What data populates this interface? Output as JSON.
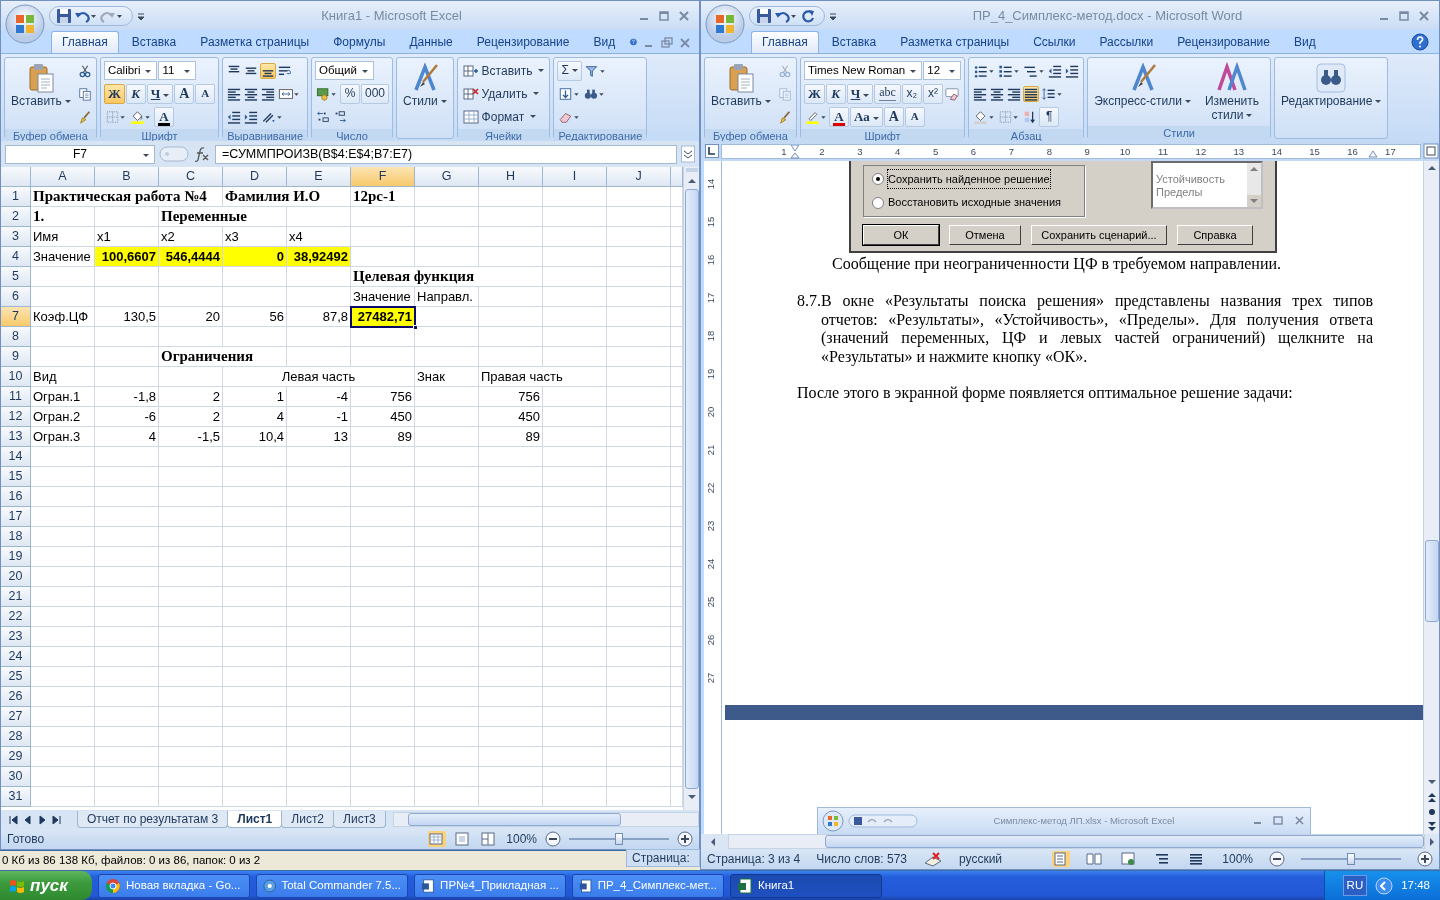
{
  "excel": {
    "title": "Книга1  -  Microsoft Excel",
    "tabs": [
      {
        "label": "Главная",
        "selected": true
      },
      {
        "label": "Вставка",
        "selected": false
      },
      {
        "label": "Разметка страницы",
        "selected": false
      },
      {
        "label": "Формулы",
        "selected": false
      },
      {
        "label": "Данные",
        "selected": false
      },
      {
        "label": "Рецензирование",
        "selected": false
      },
      {
        "label": "Вид",
        "selected": false
      }
    ],
    "ribbon": [
      {
        "title": "Буфер обмена",
        "controls": [
          {
            "kind": "paste",
            "label": "Вставить"
          },
          {
            "kind": "stack",
            "lines": [
              [
                {
                  "kind": "scissors",
                  "disabled": false
                }
              ],
              [
                {
                  "kind": "copy",
                  "disabled": false
                }
              ],
              [
                {
                  "kind": "brush",
                  "disabled": false
                }
              ]
            ]
          }
        ]
      },
      {
        "title": "Шрифт",
        "controls": [
          {
            "kind": "stack",
            "lines": [
              [
                {
                  "kind": "combo",
                  "value": "Calibri"
                },
                {
                  "kind": "combo",
                  "value": "11"
                }
              ],
              [
                {
                  "kind": "bold-glyph",
                  "label": "Ж",
                  "on": true
                },
                {
                  "kind": "italic-glyph",
                  "label": "К",
                  "on": false
                },
                {
                  "kind": "underline-glyph",
                  "label": "Ч",
                  "on": false
                },
                {
                  "kind": "grow-glyph",
                  "label": "A",
                  "on": false
                },
                {
                  "kind": "shrink-glyph",
                  "label": "A",
                  "on": false
                }
              ],
              [
                {
                  "kind": "border"
                },
                {
                  "kind": "fill"
                },
                {
                  "kind": "fontcolor-glyph",
                  "label": "A",
                  "color": "#000000"
                }
              ]
            ]
          }
        ]
      },
      {
        "title": "Выравнивание",
        "controls": [
          {
            "kind": "stack",
            "lines": [
              [
                {
                  "kind": "align-top",
                  "on": false
                },
                {
                  "kind": "align-middle",
                  "on": false
                },
                {
                  "kind": "align-bottom",
                  "on": true
                },
                {
                  "kind": "wrap",
                  "on": false
                }
              ],
              [
                {
                  "kind": "align-left"
                },
                {
                  "kind": "align-center"
                },
                {
                  "kind": "align-right"
                },
                {
                  "kind": "merge"
                }
              ],
              [
                {
                  "kind": "outdent"
                },
                {
                  "kind": "indent"
                },
                {
                  "kind": "orientation"
                }
              ]
            ]
          }
        ]
      },
      {
        "title": "Число",
        "controls": [
          {
            "kind": "stack",
            "lines": [
              [
                {
                  "kind": "combo",
                  "value": "Общий"
                }
              ],
              [
                {
                  "kind": "currency"
                },
                {
                  "kind": "glyph",
                  "label": "%"
                },
                {
                  "kind": "glyph",
                  "label": "000"
                }
              ],
              [
                {
                  "kind": "inc-decimal"
                },
                {
                  "kind": "dec-decimal"
                }
              ]
            ]
          }
        ]
      },
      {
        "controls": [
          {
            "kind": "styles",
            "label": "Стили"
          }
        ]
      },
      {
        "title": "Ячейки",
        "controls": [
          {
            "kind": "stack",
            "lines": [
              [
                {
                  "kind": "insert-cells",
                  "label": "Вставить"
                }
              ],
              [
                {
                  "kind": "delete-cells",
                  "label": "Удалить"
                }
              ],
              [
                {
                  "kind": "format-cells",
                  "label": "Формат"
                }
              ]
            ]
          }
        ]
      },
      {
        "title": "Редактирование",
        "controls": [
          {
            "kind": "stack",
            "lines": [
              [
                {
                  "kind": "sum-glyph",
                  "label": "Σ"
                },
                {
                  "kind": "sort-filter"
                }
              ],
              [
                {
                  "kind": "fill-down"
                },
                {
                  "kind": "binoculars"
                }
              ],
              [
                {
                  "kind": "eraser"
                }
              ]
            ]
          }
        ]
      }
    ],
    "name_box": "F7",
    "formula": "=СУММПРОИЗВ(B$4:E$4;B7:E7)",
    "columns": [
      "A",
      "B",
      "C",
      "D",
      "E",
      "F",
      "G",
      "H",
      "I",
      "J"
    ],
    "rows": [
      {
        "header": "1",
        "cells": [
          {
            "kind": "heading",
            "text": "Практическая работа №4",
            "selected": false
          },
          {
            "kind": "empty"
          },
          {
            "kind": "empty"
          },
          {
            "kind": "heading",
            "text": "Фамилия И.О",
            "selected": false
          },
          {
            "kind": "empty"
          },
          {
            "kind": "heading",
            "text": "12рс-1",
            "selected": false
          }
        ]
      },
      {
        "header": "2",
        "cells": [
          {
            "kind": "heading",
            "text": "1.",
            "selected": false
          },
          {
            "kind": "empty"
          },
          {
            "kind": "heading",
            "text": "Переменные",
            "selected": false
          }
        ]
      },
      {
        "header": "3",
        "cells": [
          {
            "kind": "text",
            "text": "Имя",
            "selected": false
          },
          {
            "kind": "text",
            "text": "x1",
            "selected": false
          },
          {
            "kind": "text",
            "text": "x2",
            "selected": false
          },
          {
            "kind": "text",
            "text": "x3",
            "selected": false
          },
          {
            "kind": "text",
            "text": "x4",
            "selected": false
          }
        ]
      },
      {
        "header": "4",
        "cells": [
          {
            "kind": "text",
            "text": "Значение",
            "selected": false
          },
          {
            "kind": "number",
            "text": "100,6607",
            "bold": true,
            "highlight": true,
            "selected": false
          },
          {
            "kind": "number",
            "text": "546,4444",
            "bold": true,
            "highlight": true,
            "selected": false
          },
          {
            "kind": "number",
            "text": "0",
            "bold": true,
            "highlight": true,
            "selected": false
          },
          {
            "kind": "number",
            "text": "38,92492",
            "bold": true,
            "highlight": true,
            "selected": false
          }
        ]
      },
      {
        "header": "5",
        "cells": [
          {
            "kind": "empty"
          },
          {
            "kind": "empty"
          },
          {
            "kind": "empty"
          },
          {
            "kind": "empty"
          },
          {
            "kind": "empty"
          },
          {
            "kind": "heading",
            "text": "Целевая функция",
            "selected": false
          }
        ]
      },
      {
        "header": "6",
        "cells": [
          {
            "kind": "empty"
          },
          {
            "kind": "empty"
          },
          {
            "kind": "empty"
          },
          {
            "kind": "empty"
          },
          {
            "kind": "empty"
          },
          {
            "kind": "text",
            "text": "Значение",
            "selected": false
          },
          {
            "kind": "text",
            "text": "Направл.",
            "selected": false
          }
        ]
      },
      {
        "header": "7",
        "cells": [
          {
            "kind": "text",
            "text": "Коэф.ЦФ",
            "selected": false
          },
          {
            "kind": "number",
            "text": "130,5",
            "selected": false
          },
          {
            "kind": "number",
            "text": "20",
            "selected": false
          },
          {
            "kind": "number",
            "text": "56",
            "selected": false
          },
          {
            "kind": "number",
            "text": "87,8",
            "selected": false
          },
          {
            "kind": "number",
            "text": "27482,71",
            "bold": true,
            "highlight": true,
            "selected": true
          }
        ]
      },
      {
        "header": "8"
      },
      {
        "header": "9",
        "cells": [
          {
            "kind": "empty"
          },
          {
            "kind": "empty"
          },
          {
            "kind": "heading",
            "text": "Ограничения",
            "selected": false
          }
        ]
      },
      {
        "header": "10",
        "cells": [
          {
            "kind": "text",
            "text": "Вид",
            "selected": false
          },
          {
            "kind": "empty"
          },
          {
            "kind": "empty"
          },
          {
            "kind": "empty"
          },
          {
            "kind": "text",
            "text": "Левая часть",
            "centered": true,
            "selected": false
          },
          {
            "kind": "empty"
          },
          {
            "kind": "text",
            "text": "Знак",
            "selected": false
          },
          {
            "kind": "text",
            "text": "Правая часть",
            "selected": false
          }
        ]
      },
      {
        "header": "11",
        "cells": [
          {
            "kind": "text",
            "text": "Огран.1",
            "selected": false
          },
          {
            "kind": "number",
            "text": "-1,8",
            "selected": false
          },
          {
            "kind": "number",
            "text": "2",
            "selected": false
          },
          {
            "kind": "number",
            "text": "1",
            "selected": false
          },
          {
            "kind": "number",
            "text": "-4",
            "selected": false
          },
          {
            "kind": "number",
            "text": "756",
            "selected": false
          },
          {
            "kind": "empty"
          },
          {
            "kind": "number",
            "text": "756",
            "selected": false
          }
        ]
      },
      {
        "header": "12",
        "cells": [
          {
            "kind": "text",
            "text": "Огран.2",
            "selected": false
          },
          {
            "kind": "number",
            "text": "-6",
            "selected": false
          },
          {
            "kind": "number",
            "text": "2",
            "selected": false
          },
          {
            "kind": "number",
            "text": "4",
            "selected": false
          },
          {
            "kind": "number",
            "text": "-1",
            "selected": false
          },
          {
            "kind": "number",
            "text": "450",
            "selected": false
          },
          {
            "kind": "empty"
          },
          {
            "kind": "number",
            "text": "450",
            "selected": false
          }
        ]
      },
      {
        "header": "13",
        "cells": [
          {
            "kind": "text",
            "text": "Огран.3",
            "selected": false
          },
          {
            "kind": "number",
            "text": "4",
            "selected": false
          },
          {
            "kind": "number",
            "text": "-1,5",
            "selected": false
          },
          {
            "kind": "number",
            "text": "10,4",
            "selected": false
          },
          {
            "kind": "number",
            "text": "13",
            "selected": false
          },
          {
            "kind": "number",
            "text": "89",
            "selected": false
          },
          {
            "kind": "empty"
          },
          {
            "kind": "number",
            "text": "89",
            "selected": false
          }
        ]
      },
      {
        "header": "14"
      },
      {
        "header": "15"
      },
      {
        "header": "16"
      },
      {
        "header": "17"
      },
      {
        "header": "18"
      },
      {
        "header": "19"
      },
      {
        "header": "20"
      },
      {
        "header": "21"
      },
      {
        "header": "22"
      },
      {
        "header": "23"
      },
      {
        "header": "24"
      },
      {
        "header": "25"
      },
      {
        "header": "26"
      },
      {
        "header": "27"
      },
      {
        "header": "28"
      },
      {
        "header": "29"
      },
      {
        "header": "30"
      },
      {
        "header": "31"
      }
    ],
    "sheets": [
      {
        "label": "Отчет по результатам 3",
        "selected": false
      },
      {
        "label": "Лист1",
        "selected": true
      },
      {
        "label": "Лист2",
        "selected": false
      },
      {
        "label": "Лист3",
        "selected": false
      }
    ],
    "status": "Готово",
    "views": [
      {
        "kind": "normal",
        "selected": true
      },
      {
        "kind": "page-layout",
        "selected": false
      },
      {
        "kind": "page-break",
        "selected": false
      }
    ],
    "zoom": "100%",
    "zoom_slider": {
      "level": 0.5
    }
  },
  "word": {
    "title": "ПР_4_Симплекс-метод.docx  -  Microsoft Word",
    "tabs": [
      {
        "label": "Главная",
        "selected": true
      },
      {
        "label": "Вставка",
        "selected": false
      },
      {
        "label": "Разметка страницы",
        "selected": false
      },
      {
        "label": "Ссылки",
        "selected": false
      },
      {
        "label": "Рассылки",
        "selected": false
      },
      {
        "label": "Рецензирование",
        "selected": false
      },
      {
        "label": "Вид",
        "selected": false
      }
    ],
    "ribbon": [
      {
        "title": "Буфер обмена",
        "controls": [
          {
            "kind": "paste",
            "label": "Вставить"
          },
          {
            "kind": "stack",
            "lines": [
              [
                {
                  "kind": "scissors",
                  "disabled": true
                }
              ],
              [
                {
                  "kind": "copy",
                  "disabled": true
                }
              ],
              [
                {
                  "kind": "brush",
                  "disabled": false
                }
              ]
            ]
          }
        ]
      },
      {
        "title": "Шрифт",
        "controls": [
          {
            "kind": "stack",
            "lines": [
              [
                {
                  "kind": "combo",
                  "value": "Times New Roman"
                },
                {
                  "kind": "combo",
                  "value": "12"
                }
              ],
              [
                {
                  "kind": "bold-glyph",
                  "label": "Ж",
                  "on": false
                },
                {
                  "kind": "italic-glyph",
                  "label": "К",
                  "on": false
                },
                {
                  "kind": "underline-glyph",
                  "label": "Ч",
                  "on": false
                },
                {
                  "kind": "strike-glyph",
                  "label": "abc",
                  "on": false
                },
                {
                  "kind": "glyph",
                  "label": "x₂",
                  "on": false
                },
                {
                  "kind": "glyph",
                  "label": "x²",
                  "on": false
                },
                {
                  "kind": "clear-format",
                  "on": false
                }
              ],
              [
                {
                  "kind": "highlight"
                },
                {
                  "kind": "fontcolor-glyph",
                  "label": "A",
                  "color": "#e00000"
                },
                {
                  "kind": "case-glyph",
                  "label": "Aa"
                },
                {
                  "kind": "grow-glyph",
                  "label": "A"
                },
                {
                  "kind": "shrink-glyph",
                  "label": "A"
                }
              ]
            ]
          }
        ]
      },
      {
        "title": "Абзац",
        "controls": [
          {
            "kind": "stack",
            "lines": [
              [
                {
                  "kind": "bullets"
                },
                {
                  "kind": "numbering"
                },
                {
                  "kind": "multilevel"
                },
                {
                  "kind": "outdent"
                },
                {
                  "kind": "indent"
                }
              ],
              [
                {
                  "kind": "align-left",
                  "on": false
                },
                {
                  "kind": "align-center",
                  "on": false
                },
                {
                  "kind": "align-right",
                  "on": false
                },
                {
                  "kind": "justify",
                  "on": true
                },
                {
                  "kind": "line-spacing",
                  "on": false
                }
              ],
              [
                {
                  "kind": "shading"
                },
                {
                  "kind": "border"
                },
                {
                  "kind": "sort"
                },
                {
                  "kind": "glyph",
                  "label": "¶"
                }
              ]
            ]
          }
        ]
      },
      {
        "title": "Стили",
        "controls": [
          {
            "kind": "styles",
            "label": "Экспресс-стили"
          },
          {
            "kind": "change-styles",
            "label": "Изменить стили"
          }
        ]
      },
      {
        "controls": [
          {
            "kind": "find",
            "label": "Редактирование"
          }
        ]
      }
    ],
    "ruler": {
      "marks": [
        "1",
        "2",
        "3",
        "4",
        "5",
        "6",
        "7",
        "8",
        "9",
        "10",
        "11",
        "12",
        "13",
        "14",
        "15",
        "16",
        "17"
      ]
    },
    "vertical_ruler": {
      "marks": [
        "14",
        "15",
        "16",
        "17",
        "18",
        "19",
        "20",
        "21",
        "22",
        "23",
        "24",
        "25",
        "26",
        "27"
      ]
    },
    "document": {
      "dialog": {
        "options": [
          {
            "label": "Сохранить найденное решение",
            "selected": true
          },
          {
            "label": "Восстановить исходные значения",
            "selected": false
          }
        ],
        "reports": [
          "Устойчивость",
          "Пределы"
        ],
        "buttons": [
          {
            "label": "ОК",
            "default": true
          },
          {
            "label": "Отмена",
            "default": false
          },
          {
            "label": "Сохранить сценарий...",
            "default": false
          },
          {
            "label": "Справка",
            "default": false
          }
        ]
      },
      "caption": "Сообщение при неограниченности ЦФ в требуемом направлении.",
      "list_item": {
        "number": "8.7.",
        "text": "В окне «Результаты поиска решения» представлены названия трех типов отчетов: «Результаты», «Устойчивость», «Пределы». Для получения ответа (значений переменных, ЦФ и левых частей ограничений) щелкните на «Результаты» и нажмите кнопку «ОК»."
      },
      "paragraph": "После этого в экранной форме появляется оптимальное решение задачи:",
      "embedded_window_title": "Симплекс-метод ЛП.xlsx - Microsoft Excel"
    },
    "status": {
      "page": "Страница: 3 из 4",
      "words": "Число слов: 573",
      "language": "русский"
    },
    "views": [
      {
        "kind": "print-layout",
        "selected": true
      },
      {
        "kind": "reading",
        "selected": false
      },
      {
        "kind": "web",
        "selected": false
      },
      {
        "kind": "outline",
        "selected": false
      },
      {
        "kind": "draft",
        "selected": false
      }
    ],
    "zoom": "100%",
    "zoom_slider": {
      "level": 0.5
    }
  },
  "file_manager_status": "0 Кб из 86 138 Кб, файлов: 0 из 86, папок: 0 из 2",
  "background_window_label": "Страница:",
  "taskbar": {
    "start": "пуск",
    "items": [
      {
        "kind": "browser",
        "label": "Новая вкладка - Go...",
        "selected": false
      },
      {
        "kind": "file-manager",
        "label": "Total Commander 7.5...",
        "selected": false
      },
      {
        "kind": "document",
        "label": "ПР№4_Прикладная ...",
        "selected": false
      },
      {
        "kind": "document",
        "label": "ПР_4_Симплекс-мет...",
        "selected": false
      },
      {
        "kind": "spreadsheet",
        "label": "Книга1",
        "selected": true
      }
    ],
    "language": "RU",
    "clock": "17:48"
  }
}
